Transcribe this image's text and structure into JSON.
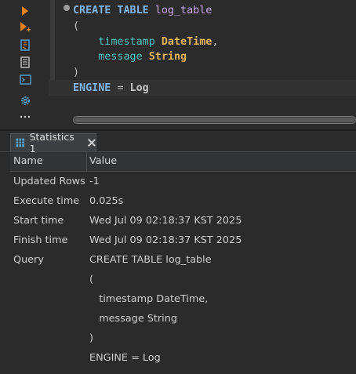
{
  "toolbar": {
    "icons": [
      "execute-statement-icon",
      "execute-script-icon",
      "explain-plan-icon",
      "show-log-icon",
      "open-console-icon",
      "settings-icon",
      "more-icon"
    ]
  },
  "editor": {
    "line1": {
      "kw": "CREATE TABLE",
      "name": "log_table"
    },
    "line2": "(",
    "line3": {
      "col": "timestamp",
      "type": "DateTime",
      "punc": ","
    },
    "line4": {
      "col": "message",
      "type": "String"
    },
    "line5": ")",
    "line6": {
      "kw": "ENGINE",
      "op": "=",
      "val": "Log"
    }
  },
  "results": {
    "tab_label": "Statistics 1",
    "columns": {
      "name": "Name",
      "value": "Value"
    },
    "rows": [
      {
        "name": "Updated Rows",
        "value": "-1"
      },
      {
        "name": "Execute time",
        "value": "0.025s"
      },
      {
        "name": "Start time",
        "value": "Wed Jul 09 02:18:37 KST 2025"
      },
      {
        "name": "Finish time",
        "value": "Wed Jul 09 02:18:37 KST 2025"
      },
      {
        "name": "Query",
        "value": "CREATE TABLE log_table"
      }
    ],
    "query_lines": [
      "(",
      "   timestamp DateTime,",
      "   message String",
      ")",
      "ENGINE = Log"
    ]
  },
  "colors": {
    "background": "#2b2b2b",
    "keyword": "#7fb3e6",
    "identifier": "#c7a7e8",
    "column": "#4fc1c0",
    "type": "#e0b55e",
    "run_icon": "#e8821e"
  }
}
